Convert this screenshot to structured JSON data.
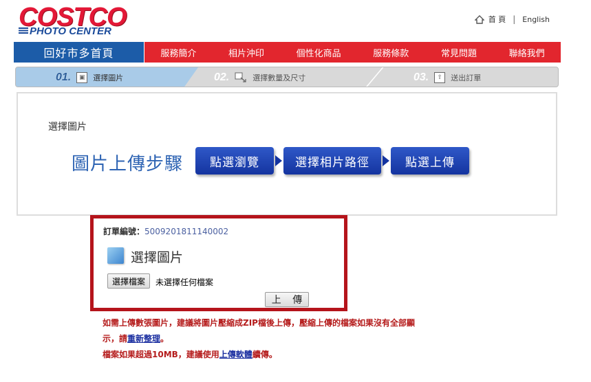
{
  "header": {
    "brand": "COSTCO",
    "subbrand": "PHOTO CENTER",
    "home_link": "首 頁",
    "separator": "|",
    "english_link": "English"
  },
  "nav": {
    "home_tab": "回好市多首頁",
    "items": [
      {
        "label": "服務簡介"
      },
      {
        "label": "相片沖印"
      },
      {
        "label": "個性化商品"
      },
      {
        "label": "服務條款"
      },
      {
        "label": "常見問題"
      },
      {
        "label": "聯絡我們"
      }
    ]
  },
  "steps": [
    {
      "num": "01.",
      "label": "選擇圖片",
      "icon": "image-icon"
    },
    {
      "num": "02.",
      "label": "選擇數量及尺寸",
      "icon": "resize-icon"
    },
    {
      "num": "03.",
      "label": "送出訂單",
      "icon": "send-icon"
    }
  ],
  "content": {
    "section_title": "選擇圖片",
    "heading": "圖片上傳步驟",
    "flow": [
      "點選瀏覽",
      "選擇相片路徑",
      "點選上傳"
    ]
  },
  "upload": {
    "order_label": "訂單編號：",
    "order_value": "5009201811140002",
    "title": "選擇圖片",
    "file_button": "選擇檔案",
    "file_status": "未選擇任何檔案",
    "upload_button": "上 傳"
  },
  "notes": {
    "line1": "如需上傳數張圖片，建議將圖片壓縮成ZIP檔後上傳，壓縮上傳的檔案如果沒有全部顯",
    "line2_pre": "示，請",
    "line2_link": "重新整理",
    "line2_post": "。",
    "line3_pre": "檔案如果超過10MB，建議使用",
    "line3_link": "上傳軟體",
    "line3_post": "續傳。"
  },
  "colors": {
    "brand_red": "#e31837",
    "brand_blue": "#1a4a9a",
    "nav_red": "#e2262e",
    "nav_blue": "#1c5ca8",
    "panel_border": "#b5141b"
  }
}
